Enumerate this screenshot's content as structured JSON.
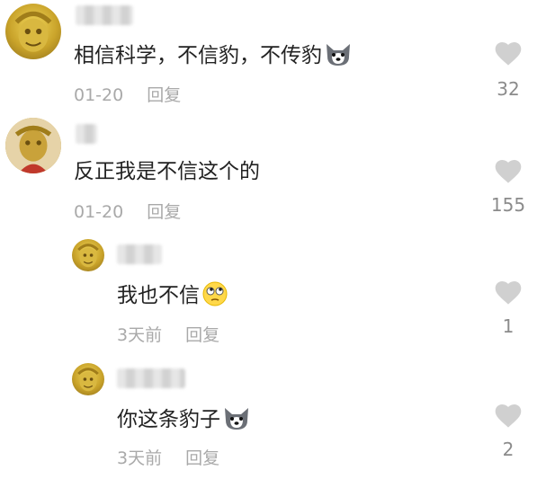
{
  "comments": [
    {
      "text": "相信科学，不信豹，不传豹",
      "emoji": "dog-face-icon",
      "date": "01-20",
      "reply": "回复",
      "likes": "32"
    },
    {
      "text": "反正我是不信这个的",
      "emoji": "",
      "date": "01-20",
      "reply": "回复",
      "likes": "155"
    },
    {
      "text": "我也不信",
      "emoji": "rolling-eyes-icon",
      "date": "3天前",
      "reply": "回复",
      "likes": "1"
    },
    {
      "text": "你这条豹子",
      "emoji": "dog-face-icon",
      "date": "3天前",
      "reply": "回复",
      "likes": "2"
    }
  ],
  "colors": {
    "heart": "#d0d0d0",
    "meta": "#a9a9a9",
    "text": "#222222"
  }
}
